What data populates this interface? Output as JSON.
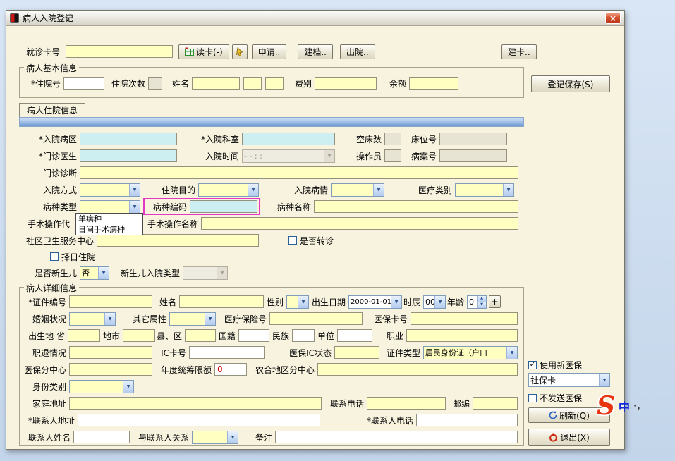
{
  "window": {
    "title": "病人入院登记"
  },
  "icons": {
    "dropdown": "▼",
    "check": "✓",
    "up": "▲",
    "down": "▼",
    "close": "×",
    "plus": "+"
  },
  "colors": {
    "field_yellow": "#ffffc2",
    "field_blue": "#cdeff1",
    "highlight_magenta": "#e437c3",
    "accent_blue_band": "#6f9bd2",
    "required_red": "#cc0000"
  },
  "toolbar": {
    "visit_card_label": "就诊卡号",
    "read_card": "读卡(-)",
    "apply": "申请..",
    "archive": "建档..",
    "discharge": "出院..",
    "create_card": "建卡.."
  },
  "basic": {
    "title": "病人基本信息",
    "inpatient_no_label": "*住院号",
    "visit_count_label": "住院次数",
    "name_label": "姓名",
    "fee_label": "费别",
    "balance_label": "余额"
  },
  "tabs": {
    "inpatient_info": "病人住院信息"
  },
  "adm": {
    "ward_label": "*入院病区",
    "dept_label": "*入院科室",
    "empty_beds_label": "空床数",
    "bed_no_label": "床位号",
    "doctor_label": "*门诊医生",
    "time_label": "入院时间",
    "time_value": "- -   :  :",
    "operator_label": "操作员",
    "case_no_label": "病案号",
    "diagnosis_label": "门诊诊断",
    "mode_label": "入院方式",
    "purpose_label": "住院目的",
    "condition_label": "入院病情",
    "med_type_label": "医疗类别",
    "disease_type_label": "病种类型",
    "disease_type_options": [
      "单病种",
      "日间手术病种"
    ],
    "disease_code_label": "病种编码",
    "disease_name_label": "病种名称",
    "op_code_label": "手术操作代",
    "op_name_label": "手术操作名称",
    "community_label": "社区卫生服务中心",
    "referral_label": "是否转诊",
    "scheduled_label": "择日住院",
    "newborn_label": "是否新生儿",
    "newborn_value": "否",
    "newborn_type_label": "新生儿入院类型"
  },
  "detail": {
    "title": "病人详细信息",
    "cert_no_label": "*证件编号",
    "name_label": "姓名",
    "gender_label": "性别",
    "birth_label": "出生日期",
    "birth_value": "2000-01-01",
    "hour_label": "时辰",
    "hour_value": "00",
    "age_label": "年龄",
    "age_value": "0",
    "marital_label": "婚姻状况",
    "other_attr_label": "其它属性",
    "med_ins_no_label": "医疗保险号",
    "med_card_no_label": "医保卡号",
    "birthplace_label": "出生地 省",
    "city_label": "地市",
    "county_label": "县、区",
    "nationality_label": "国籍",
    "ethnic_label": "民族",
    "employer_label": "单位",
    "occupation_label": "职业",
    "job_status_label": "职退情况",
    "ic_card_label": "IC卡号",
    "ic_status_label": "医保IC状态",
    "cert_type_label": "证件类型",
    "cert_type_value": "居民身份证（户口",
    "ins_center_label": "医保分中心",
    "annual_limit_label": "年度统筹限额",
    "annual_limit_value": "0",
    "rural_center_label": "农合地区分中心",
    "identity_label": "身份类别",
    "home_addr_label": "家庭地址",
    "phone_label": "联系电话",
    "zip_label": "邮编",
    "contact_addr_label": "*联系人地址",
    "contact_phone_label": "*联系人电话",
    "contact_name_label": "联系人姓名",
    "contact_rel_label": "与联系人关系",
    "remark_label": "备注"
  },
  "side": {
    "save": "登记保存(S)",
    "use_new_ins": "使用新医保",
    "card_type_value": "社保卡",
    "no_send_ins": "不发送医保",
    "refresh": "刷新(Q)",
    "exit": "退出(X)"
  },
  "ime": {
    "logo": "S",
    "lang": "中",
    "marks": "·,"
  }
}
